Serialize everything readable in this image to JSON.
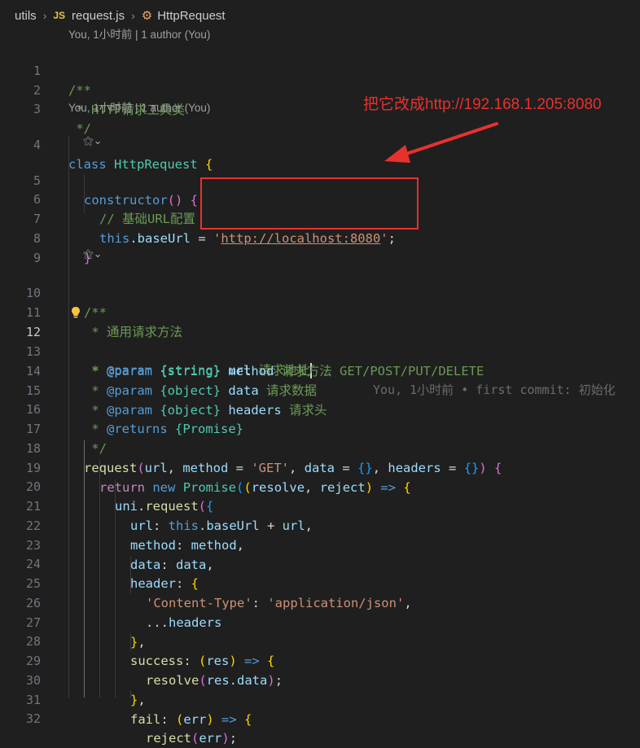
{
  "breadcrumb": {
    "folder": "utils",
    "file_badge": "JS",
    "file": "request.js",
    "symbol": "HttpRequest"
  },
  "codelens": {
    "blame1": "You, 1小时前 | 1 author (You)",
    "blame2": "You, 1小时前 | 1 author (You)"
  },
  "inline_blame": "You, 1小时前 • first commit: 初始化",
  "annotation": {
    "text": "把它改成http://192.168.1.205:8080",
    "color": "#e8312d"
  },
  "line_numbers": [
    "1",
    "2",
    "3",
    "4",
    "5",
    "6",
    "7",
    "8",
    "9",
    "10",
    "11",
    "12",
    "13",
    "14",
    "15",
    "16",
    "17",
    "18",
    "19",
    "20",
    "21",
    "22",
    "23",
    "24",
    "25",
    "26",
    "27",
    "28",
    "29",
    "30",
    "31",
    "32"
  ],
  "code": {
    "l1": "/**",
    "l2": " * HTTP请求工具类",
    "l3": " */",
    "l4_kw": "class",
    "l4_name": "HttpRequest",
    "l4_brace": "{",
    "l5_fn": "constructor",
    "l5_parens": "()",
    "l5_brace": "{",
    "l6": "// 基础URL配置",
    "l7_this": "this",
    "l7_prop": ".baseUrl",
    "l7_eq": " = ",
    "l7_q1": "'",
    "l7_url": "http://localhost:8080",
    "l7_q2": "'",
    "l7_end": ";",
    "l8": "}",
    "l10": "/**",
    "l11": " * 通用请求方法",
    "l12_a": " * ",
    "l12_tag": "@param",
    "l12_type": "{string}",
    "l12_name": "url",
    "l12_desc": "请求地址",
    "l13_a": " * ",
    "l13_tag": "@param",
    "l13_type": "{string}",
    "l13_name": "method",
    "l13_desc": "请求方法 GET/POST/PUT/DELETE",
    "l14_a": " * ",
    "l14_tag": "@param",
    "l14_type": "{object}",
    "l14_name": "data",
    "l14_desc": "请求数据",
    "l15_a": " * ",
    "l15_tag": "@param",
    "l15_type": "{object}",
    "l15_name": "headers",
    "l15_desc": "请求头",
    "l16_a": " * ",
    "l16_tag": "@returns",
    "l16_type": "{Promise}",
    "l17": " */",
    "l18_fn": "request",
    "l18_p1": "(",
    "l18_url": "url",
    "l18_c1": ", ",
    "l18_method": "method",
    "l18_eq1": " = ",
    "l18_get": "'GET'",
    "l18_c2": ", ",
    "l18_data": "data",
    "l18_eq2": " = ",
    "l18_obj1": "{}",
    "l18_c3": ", ",
    "l18_headers": "headers",
    "l18_eq3": " = ",
    "l18_obj2": "{}",
    "l18_p2": ")",
    "l18_brace": " {",
    "l19_ret": "return",
    "l19_new": "new",
    "l19_promise": "Promise",
    "l19_p1": "(",
    "l19_p2": "(",
    "l19_resolve": "resolve",
    "l19_c": ", ",
    "l19_reject": "reject",
    "l19_p3": ")",
    "l19_arrow": " => ",
    "l19_brace": "{",
    "l20_uni": "uni",
    "l20_dot": ".",
    "l20_fn": "request",
    "l20_p": "(",
    "l20_b": "{",
    "l21_key": "url",
    "l21_colon": ": ",
    "l21_this": "this",
    "l21_prop": ".baseUrl",
    "l21_plus": " + ",
    "l21_url": "url",
    "l21_comma": ",",
    "l22_key": "method",
    "l22_colon": ": ",
    "l22_val": "method",
    "l22_comma": ",",
    "l23_key": "data",
    "l23_colon": ": ",
    "l23_val": "data",
    "l23_comma": ",",
    "l24_key": "header",
    "l24_colon": ": ",
    "l24_brace": "{",
    "l25_key": "'Content-Type'",
    "l25_colon": ": ",
    "l25_val": "'application/json'",
    "l25_comma": ",",
    "l26_spread": "...",
    "l26_val": "headers",
    "l27_brace": "}",
    "l27_comma": ",",
    "l28_key": "success",
    "l28_colon": ": ",
    "l28_p1": "(",
    "l28_arg": "res",
    "l28_p2": ")",
    "l28_arrow": " => ",
    "l28_brace": "{",
    "l29_fn": "resolve",
    "l29_p1": "(",
    "l29_res": "res",
    "l29_prop": ".data",
    "l29_p2": ")",
    "l29_end": ";",
    "l30_brace": "}",
    "l30_comma": ",",
    "l31_key": "fail",
    "l31_colon": ": ",
    "l31_p1": "(",
    "l31_arg": "err",
    "l31_p2": ")",
    "l31_arrow": " => ",
    "l31_brace": "{",
    "l32_fn": "reject",
    "l32_p1": "(",
    "l32_arg": "err",
    "l32_p2": ")",
    "l32_end": ";"
  }
}
